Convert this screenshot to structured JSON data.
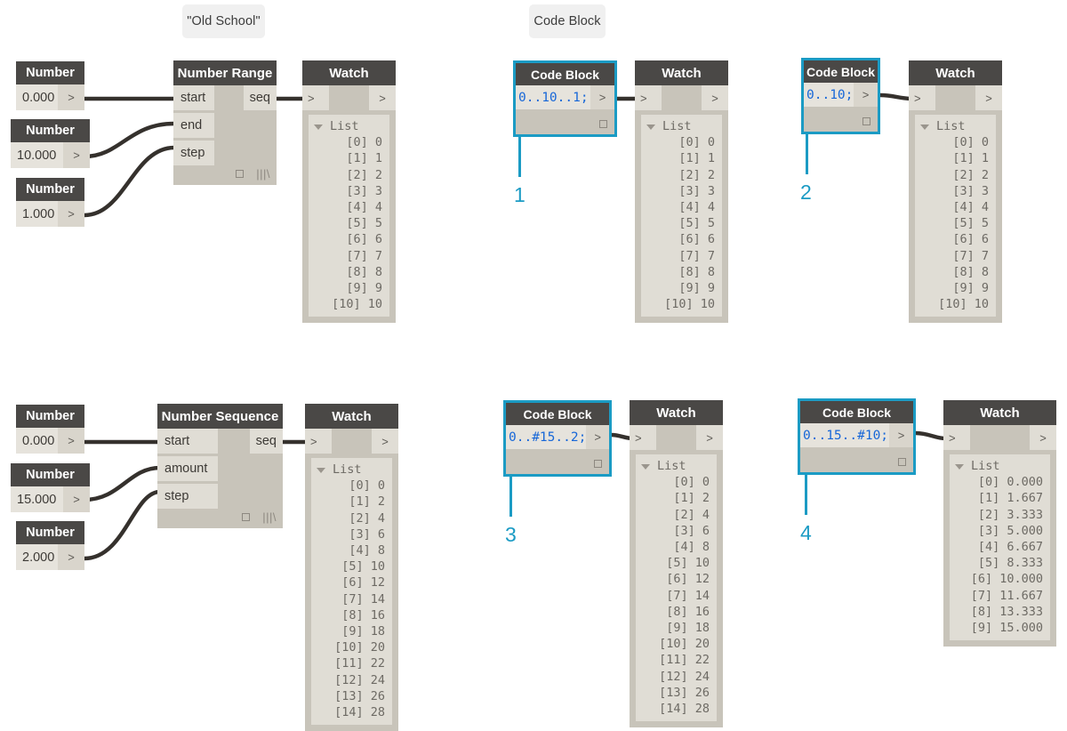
{
  "annotations": {
    "old_school_label": "\"Old School\"",
    "code_block_label": "Code Block",
    "markers": [
      "1",
      "2",
      "3",
      "4"
    ]
  },
  "colors": {
    "accent": "#1b9bc4",
    "node_header": "#4a4846",
    "node_body": "#c8c4ba",
    "port": "#e0ddd5",
    "code_text": "#1767d8",
    "list_text": "#6d6a64",
    "wire": "#35312d"
  },
  "icons": {
    "port_arrow": ">",
    "freeze_square": "square-icon",
    "lacing": "lacing-icon",
    "collapse_triangle": "triangle-collapse-icon"
  },
  "graph_1": {
    "title": "\"Old School\"",
    "number_nodes": [
      {
        "header": "Number",
        "value": "0.000",
        "port": ">"
      },
      {
        "header": "Number",
        "value": "10.000",
        "port": ">"
      },
      {
        "header": "Number",
        "value": "1.000",
        "port": ">"
      }
    ],
    "function_node": {
      "header": "Number Range",
      "inputs": [
        "start",
        "end",
        "step"
      ],
      "output": "seq"
    },
    "watch": {
      "header": "Watch",
      "in_port": ">",
      "out_port": ">",
      "list_label": "List",
      "rows": [
        "[0] 0",
        "[1] 1",
        "[2] 2",
        "[3] 3",
        "[4] 4",
        "[5] 5",
        "[6] 6",
        "[7] 7",
        "[8] 8",
        "[9] 9",
        "[10] 10"
      ]
    }
  },
  "graph_2": {
    "marker": "1",
    "code_block": {
      "header": "Code Block",
      "code": "0..10..1;",
      "port": ">"
    },
    "watch": {
      "header": "Watch",
      "in_port": ">",
      "out_port": ">",
      "list_label": "List",
      "rows": [
        "[0] 0",
        "[1] 1",
        "[2] 2",
        "[3] 3",
        "[4] 4",
        "[5] 5",
        "[6] 6",
        "[7] 7",
        "[8] 8",
        "[9] 9",
        "[10] 10"
      ]
    }
  },
  "graph_3": {
    "marker": "2",
    "code_block": {
      "header": "Code Block",
      "code": "0..10;",
      "port": ">"
    },
    "watch": {
      "header": "Watch",
      "in_port": ">",
      "out_port": ">",
      "list_label": "List",
      "rows": [
        "[0] 0",
        "[1] 1",
        "[2] 2",
        "[3] 3",
        "[4] 4",
        "[5] 5",
        "[6] 6",
        "[7] 7",
        "[8] 8",
        "[9] 9",
        "[10] 10"
      ]
    }
  },
  "graph_4": {
    "number_nodes": [
      {
        "header": "Number",
        "value": "0.000",
        "port": ">"
      },
      {
        "header": "Number",
        "value": "15.000",
        "port": ">"
      },
      {
        "header": "Number",
        "value": "2.000",
        "port": ">"
      }
    ],
    "function_node": {
      "header": "Number Sequence",
      "inputs": [
        "start",
        "amount",
        "step"
      ],
      "output": "seq"
    },
    "watch": {
      "header": "Watch",
      "in_port": ">",
      "out_port": ">",
      "list_label": "List",
      "rows": [
        "[0] 0",
        "[1] 2",
        "[2] 4",
        "[3] 6",
        "[4] 8",
        "[5] 10",
        "[6] 12",
        "[7] 14",
        "[8] 16",
        "[9] 18",
        "[10] 20",
        "[11] 22",
        "[12] 24",
        "[13] 26",
        "[14] 28"
      ]
    }
  },
  "graph_5": {
    "marker": "3",
    "code_block": {
      "header": "Code Block",
      "code": "0..#15..2;",
      "port": ">"
    },
    "watch": {
      "header": "Watch",
      "in_port": ">",
      "out_port": ">",
      "list_label": "List",
      "rows": [
        "[0] 0",
        "[1] 2",
        "[2] 4",
        "[3] 6",
        "[4] 8",
        "[5] 10",
        "[6] 12",
        "[7] 14",
        "[8] 16",
        "[9] 18",
        "[10] 20",
        "[11] 22",
        "[12] 24",
        "[13] 26",
        "[14] 28"
      ]
    }
  },
  "graph_6": {
    "marker": "4",
    "code_block": {
      "header": "Code Block",
      "code": "0..15..#10;",
      "port": ">"
    },
    "watch": {
      "header": "Watch",
      "in_port": ">",
      "out_port": ">",
      "list_label": "List",
      "rows": [
        "[0] 0.000",
        "[1] 1.667",
        "[2] 3.333",
        "[3] 5.000",
        "[4] 6.667",
        "[5] 8.333",
        "[6] 10.000",
        "[7] 11.667",
        "[8] 13.333",
        "[9] 15.000"
      ]
    }
  }
}
